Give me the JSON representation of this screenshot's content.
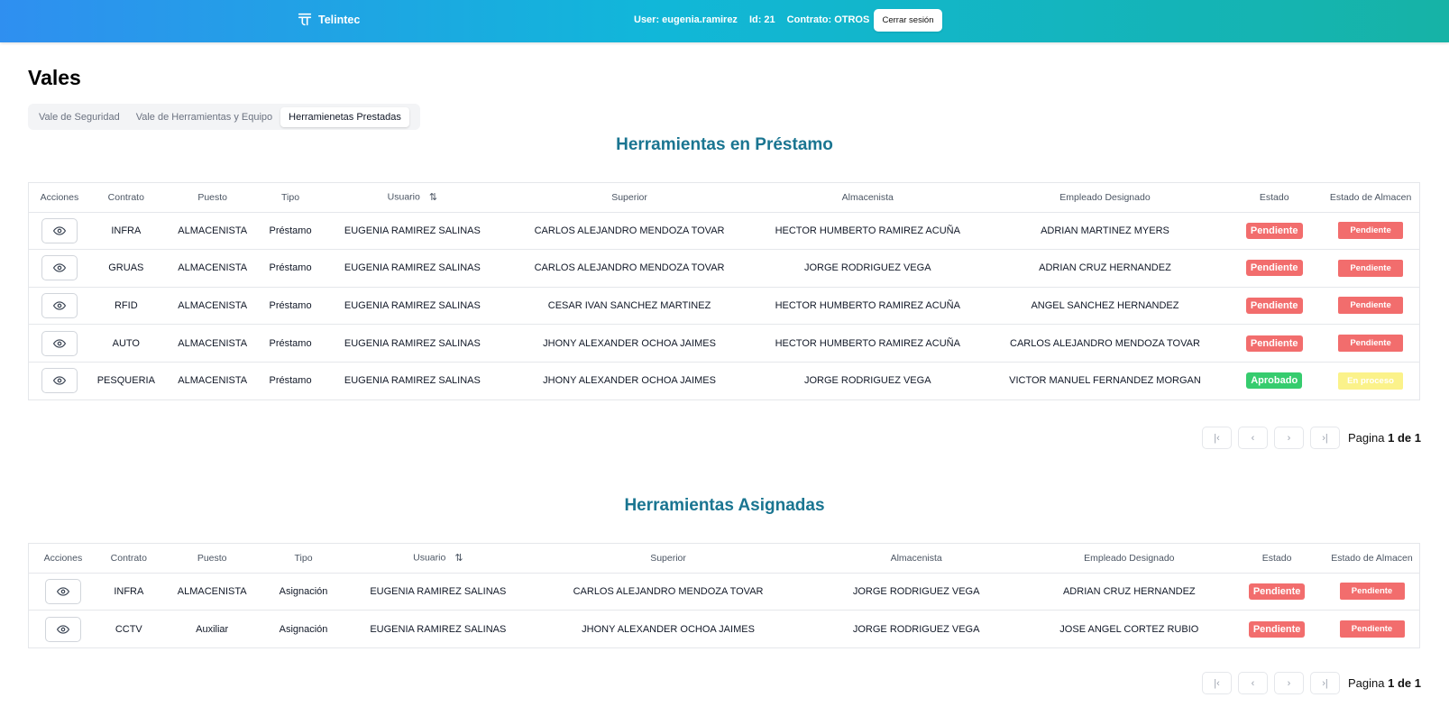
{
  "header": {
    "brand": "Telintec",
    "user_label": "User: eugenia.ramirez",
    "id_label": "Id: 21",
    "contract_label": "Contrato: OTROS",
    "logout_label": "Cerrar sesión",
    "gradient_colors": [
      "#2f8ff0",
      "#11b7d9",
      "#16b3a6"
    ]
  },
  "page": {
    "title": "Vales"
  },
  "tabs": [
    {
      "label": "Vale de Seguridad",
      "active": false
    },
    {
      "label": "Vale de Herramientas y Equipo",
      "active": false
    },
    {
      "label": "Herramienetas Prestadas",
      "active": true
    }
  ],
  "loans": {
    "title": "Herramientas en Préstamo",
    "columns": [
      "Acciones",
      "Contrato",
      "Puesto",
      "Tipo",
      "Usuario",
      "Superior",
      "Almacenista",
      "Empleado Designado",
      "Estado",
      "Estado de Almacen"
    ],
    "rows": [
      {
        "contrato": "INFRA",
        "puesto": "ALMACENISTA",
        "tipo": "Préstamo",
        "usuario": "EUGENIA RAMIREZ SALINAS",
        "superior": "CARLOS ALEJANDRO MENDOZA TOVAR",
        "almacenista": "HECTOR HUMBERTO RAMIREZ ACUÑA",
        "empleado": "ADRIAN MARTINEZ MYERS",
        "estado": "Pendiente",
        "estado_almacen": "Pendiente"
      },
      {
        "contrato": "GRUAS",
        "puesto": "ALMACENISTA",
        "tipo": "Préstamo",
        "usuario": "EUGENIA RAMIREZ SALINAS",
        "superior": "CARLOS ALEJANDRO MENDOZA TOVAR",
        "almacenista": "JORGE RODRIGUEZ VEGA",
        "empleado": "ADRIAN CRUZ HERNANDEZ",
        "estado": "Pendiente",
        "estado_almacen": "Pendiente"
      },
      {
        "contrato": "RFID",
        "puesto": "ALMACENISTA",
        "tipo": "Préstamo",
        "usuario": "EUGENIA RAMIREZ SALINAS",
        "superior": "CESAR IVAN SANCHEZ MARTINEZ",
        "almacenista": "HECTOR HUMBERTO RAMIREZ ACUÑA",
        "empleado": "ANGEL SANCHEZ HERNANDEZ",
        "estado": "Pendiente",
        "estado_almacen": "Pendiente"
      },
      {
        "contrato": "AUTO",
        "puesto": "ALMACENISTA",
        "tipo": "Préstamo",
        "usuario": "EUGENIA RAMIREZ SALINAS",
        "superior": "JHONY ALEXANDER OCHOA JAIMES",
        "almacenista": "HECTOR HUMBERTO RAMIREZ ACUÑA",
        "empleado": "CARLOS ALEJANDRO MENDOZA TOVAR",
        "estado": "Pendiente",
        "estado_almacen": "Pendiente"
      },
      {
        "contrato": "PESQUERIA",
        "puesto": "ALMACENISTA",
        "tipo": "Préstamo",
        "usuario": "EUGENIA RAMIREZ SALINAS",
        "superior": "JHONY ALEXANDER OCHOA JAIMES",
        "almacenista": "JORGE RODRIGUEZ VEGA",
        "empleado": "VICTOR MANUEL FERNANDEZ MORGAN",
        "estado": "Aprobado",
        "estado_almacen": "En proceso"
      }
    ],
    "pagination": {
      "prefix": "Pagina",
      "current": "1",
      "sep": "de",
      "total": "1"
    }
  },
  "assigned": {
    "title": "Herramientas Asignadas",
    "columns": [
      "Acciones",
      "Contrato",
      "Puesto",
      "Tipo",
      "Usuario",
      "Superior",
      "Almacenista",
      "Empleado Designado",
      "Estado",
      "Estado de Almacen"
    ],
    "rows": [
      {
        "contrato": "INFRA",
        "puesto": "ALMACENISTA",
        "tipo": "Asignación",
        "usuario": "EUGENIA RAMIREZ SALINAS",
        "superior": "CARLOS ALEJANDRO MENDOZA TOVAR",
        "almacenista": "JORGE RODRIGUEZ VEGA",
        "empleado": "ADRIAN CRUZ HERNANDEZ",
        "estado": "Pendiente",
        "estado_almacen": "Pendiente"
      },
      {
        "contrato": "CCTV",
        "puesto": "Auxiliar",
        "tipo": "Asignación",
        "usuario": "EUGENIA RAMIREZ SALINAS",
        "superior": "JHONY ALEXANDER OCHOA JAIMES",
        "almacenista": "JORGE RODRIGUEZ VEGA",
        "empleado": "JOSE ANGEL CORTEZ RUBIO",
        "estado": "Pendiente",
        "estado_almacen": "Pendiente"
      }
    ],
    "pagination": {
      "prefix": "Pagina",
      "current": "1",
      "sep": "de",
      "total": "1"
    }
  },
  "colors": {
    "pending": "#f26d6d",
    "approved": "#36cc6e",
    "in_process": "#fbf28a",
    "section_title": "#1a7591"
  }
}
